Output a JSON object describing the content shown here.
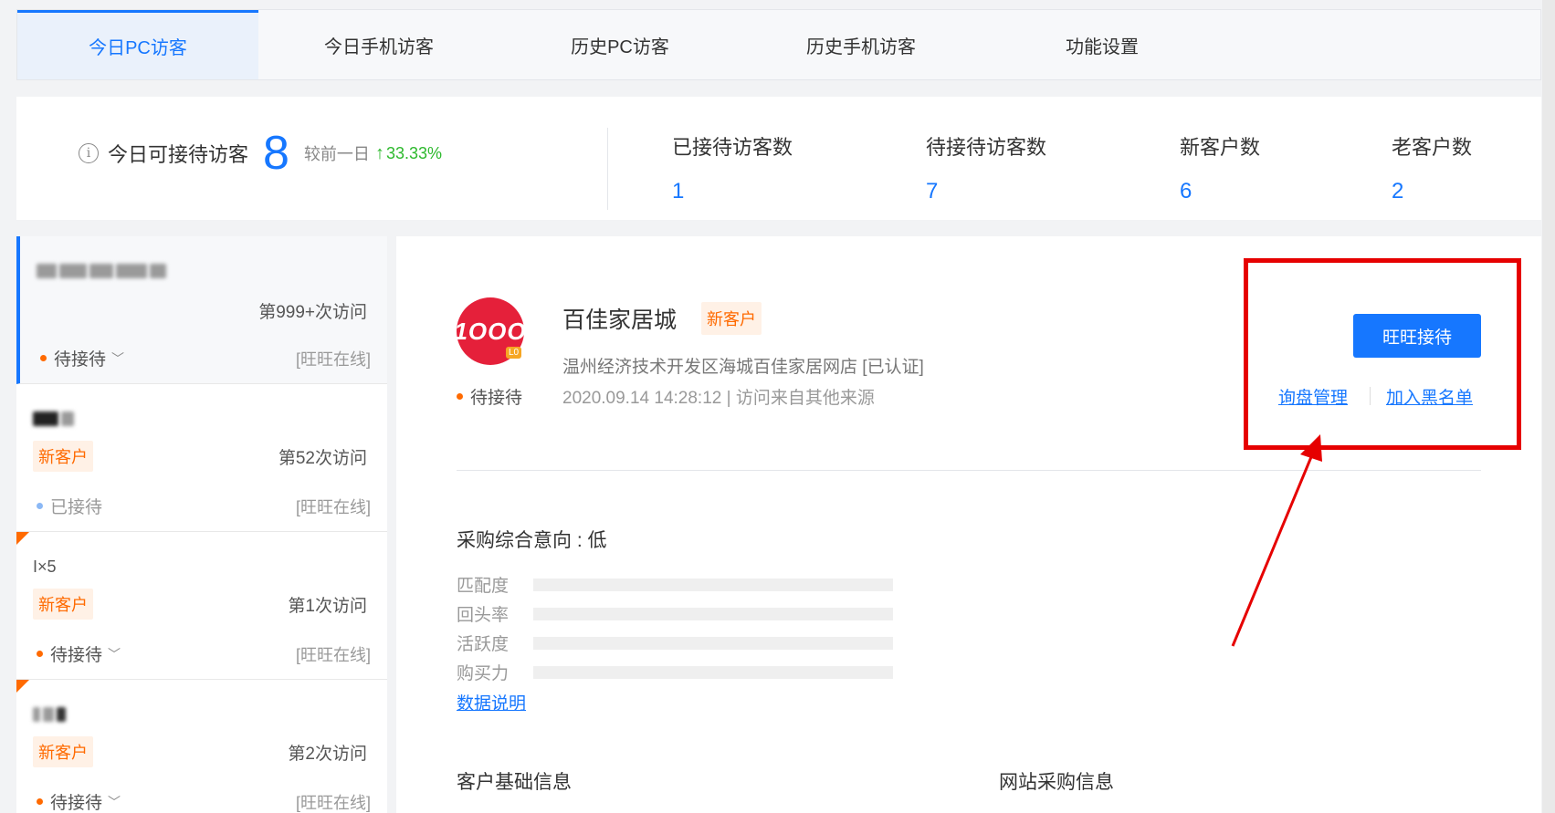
{
  "tabs": [
    {
      "label": "今日PC访客",
      "active": true
    },
    {
      "label": "今日手机访客"
    },
    {
      "label": "历史PC访客"
    },
    {
      "label": "历史手机访客"
    },
    {
      "label": "功能设置"
    }
  ],
  "stats": {
    "today_label": "今日可接待访客",
    "today_count": "8",
    "compare_label": "较前一日",
    "compare_value": "33.33%",
    "cols": [
      {
        "label": "已接待访客数",
        "value": "1"
      },
      {
        "label": "待接待访客数",
        "value": "7"
      },
      {
        "label": "新客户数",
        "value": "6"
      },
      {
        "label": "老客户数",
        "value": "2"
      }
    ]
  },
  "visitors": [
    {
      "visits": "第999+次访问",
      "status": "待接待",
      "online": "[旺旺在线]"
    },
    {
      "badge": "新客户",
      "visits": "第52次访问",
      "status": "已接待",
      "online": "[旺旺在线]"
    },
    {
      "name": "I×5",
      "badge": "新客户",
      "visits": "第1次访问",
      "status": "待接待",
      "online": "[旺旺在线]"
    },
    {
      "badge": "新客户",
      "visits": "第2次访问",
      "status": "待接待",
      "online": "[旺旺在线]"
    }
  ],
  "detail": {
    "logo_text": "1OOO",
    "logo_badge": "L0",
    "shop_name": "百佳家居城",
    "badge": "新客户",
    "address": "温州经济技术开发区海城百佳家居网店 [已认证]",
    "time_source": "2020.09.14 14:28:12 | 访问来自其他来源",
    "status": "待接待",
    "receive_button": "旺旺接待",
    "inquiry_link": "询盘管理",
    "blacklist_link": "加入黑名单",
    "intent_title": "采购综合意向 : 低",
    "metrics": [
      {
        "label": "匹配度",
        "value": 0
      },
      {
        "label": "回头率",
        "value": 0
      },
      {
        "label": "活跃度",
        "value": 0
      },
      {
        "label": "购买力",
        "value": 0
      }
    ],
    "data_link": "数据说明",
    "section_basic": "客户基础信息",
    "section_purchase": "网站采购信息"
  },
  "colors": {
    "accent": "#1677ff",
    "highlight": "#e60000",
    "new_badge": "#ff6a00",
    "up": "#2db92d"
  }
}
